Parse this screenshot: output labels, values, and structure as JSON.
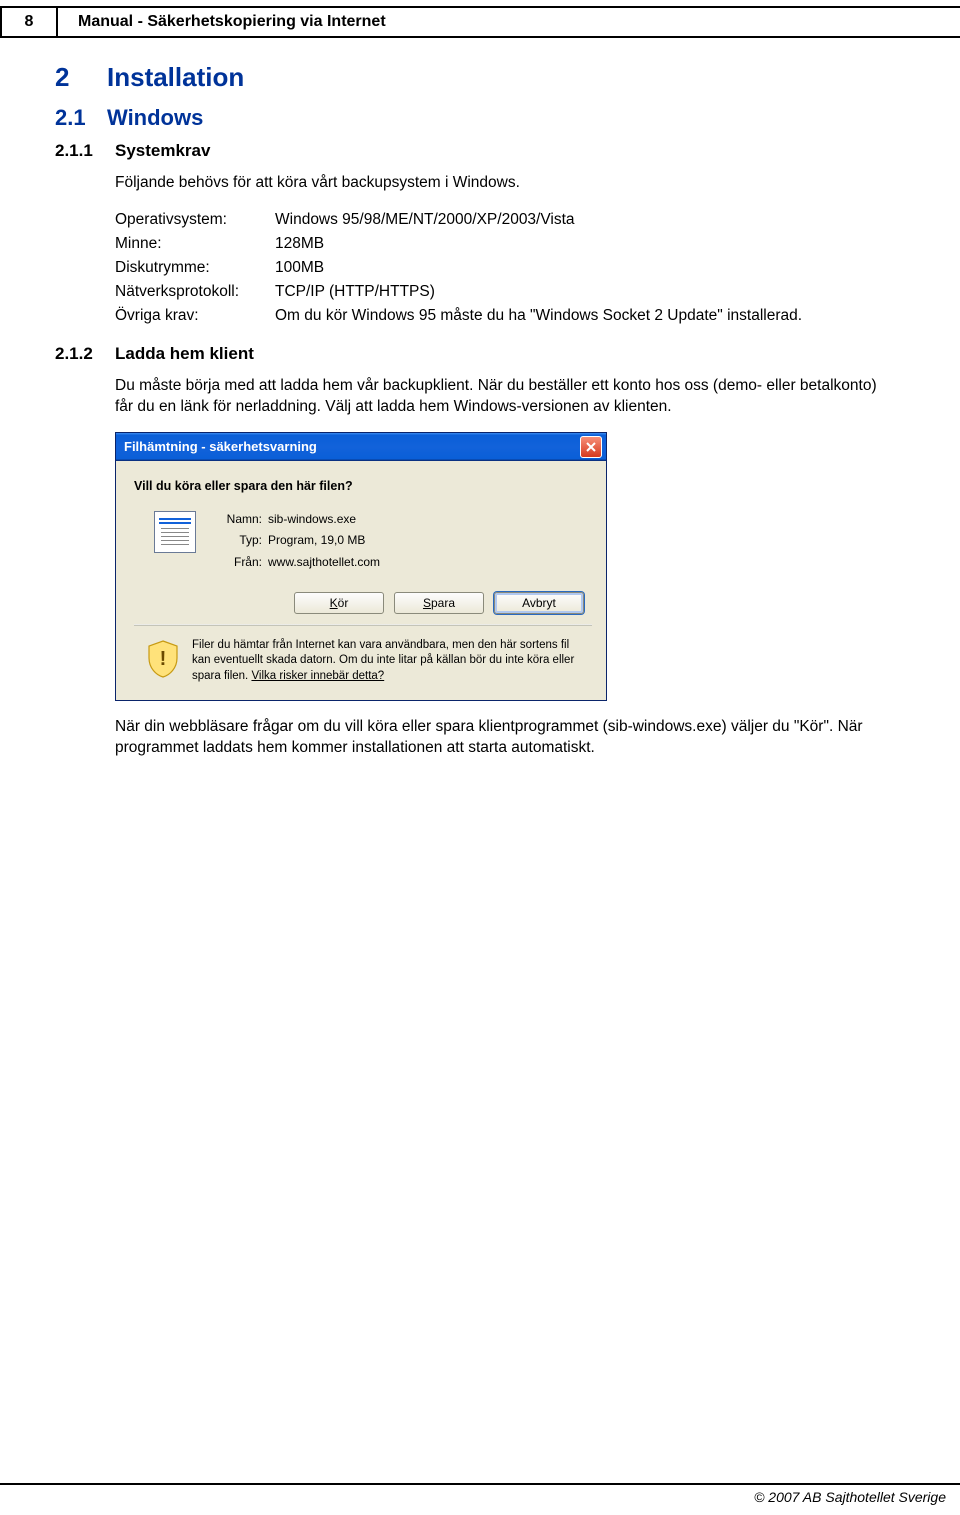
{
  "page_number": "8",
  "header_title": "Manual - Säkerhetskopiering via Internet",
  "h1": {
    "num": "2",
    "title": "Installation"
  },
  "h2": {
    "num": "2.1",
    "title": "Windows"
  },
  "h3a": {
    "num": "2.1.1",
    "title": "Systemkrav"
  },
  "h3b": {
    "num": "2.1.2",
    "title": "Ladda hem klient"
  },
  "intro211": "Följande behövs för att köra vårt backupsystem i Windows.",
  "req": {
    "r1": {
      "label": "Operativsystem:",
      "value": "Windows 95/98/ME/NT/2000/XP/2003/Vista"
    },
    "r2": {
      "label": "Minne:",
      "value": "128MB"
    },
    "r3": {
      "label": "Diskutrymme:",
      "value": "100MB"
    },
    "r4": {
      "label": "Nätverksprotokoll:",
      "value": "TCP/IP (HTTP/HTTPS)"
    },
    "r5": {
      "label": "Övriga krav:",
      "value": "Om du kör Windows 95 måste du ha \"Windows Socket 2 Update\" installerad."
    }
  },
  "intro212": "Du måste börja med att ladda hem vår backupklient. När du beställer ett konto hos oss (demo- eller betalkonto) får du en länk för nerladdning. Välj att ladda hem Windows-versionen av klienten.",
  "dialog": {
    "title": "Filhämtning - säkerhetsvarning",
    "question": "Vill du köra eller spara den här filen?",
    "name_k": "Namn:",
    "name_v": "sib-windows.exe",
    "type_k": "Typ:",
    "type_v": "Program, 19,0 MB",
    "from_k": "Från:",
    "from_v": "www.sajthotellet.com",
    "btn_run": "Kör",
    "btn_save": "Spara",
    "btn_cancel": "Avbryt",
    "warn_text": "Filer du hämtar från Internet kan vara användbara, men den här sortens fil kan eventuellt skada datorn. Om du inte litar på källan bör du inte köra eller spara filen. ",
    "warn_link": "Vilka risker innebär detta?"
  },
  "after_dialog": "När din webbläsare frågar om du vill köra eller spara klientprogrammet (sib-windows.exe) väljer du \"Kör\". När programmet laddats hem kommer installationen att starta automatiskt.",
  "footer": "© 2007 AB Sajthotellet Sverige"
}
